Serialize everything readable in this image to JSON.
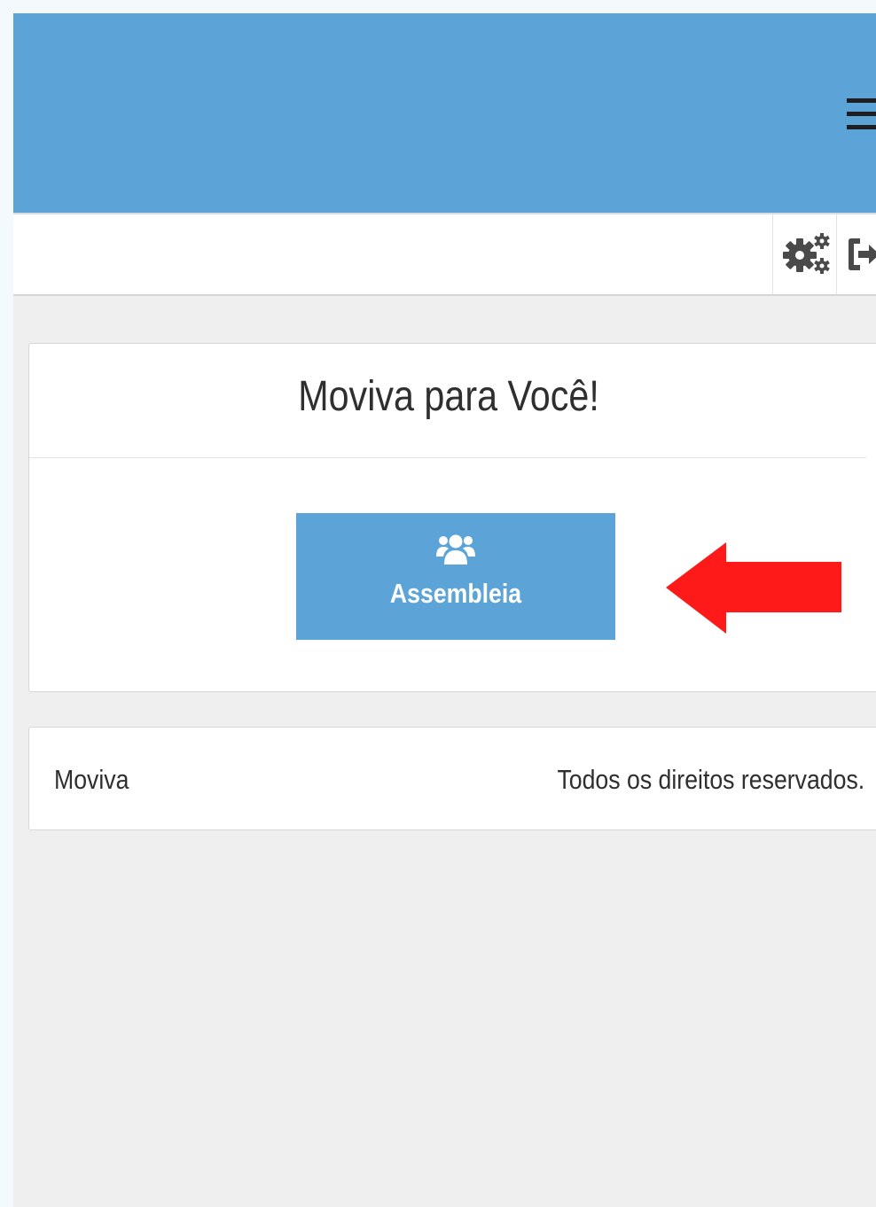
{
  "header": {
    "menu_icon": "hamburger-icon",
    "background_color": "#5ca4d7"
  },
  "toolbar": {
    "settings_icon": "gears-icon",
    "logout_icon": "sign-out-icon"
  },
  "panel": {
    "title": "Moviva para Você!",
    "assembleia_button": {
      "label": "Assembleia",
      "icon": "users-icon",
      "color": "#5ca4d7"
    }
  },
  "annotation": {
    "arrow_color": "#ff1a1a",
    "arrow_direction": "left"
  },
  "footer": {
    "brand": "Moviva",
    "rights": "Todos os direitos reservados."
  }
}
